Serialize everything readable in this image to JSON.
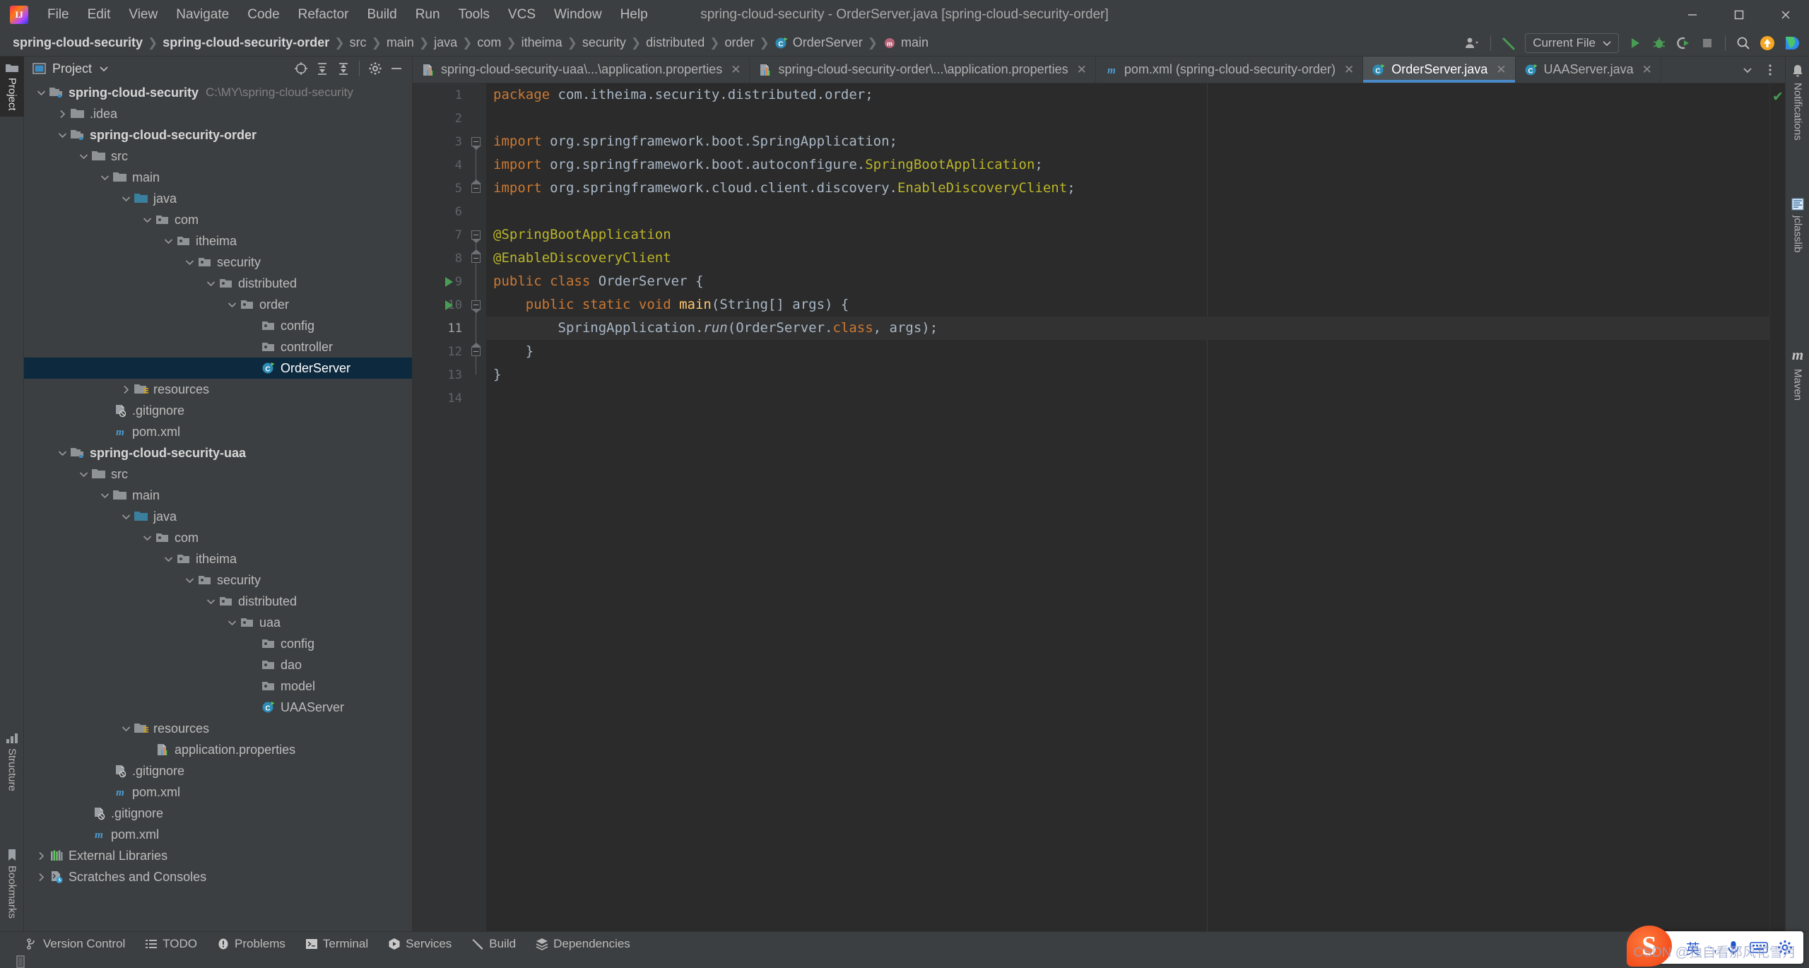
{
  "window": {
    "title": "spring-cloud-security - OrderServer.java [spring-cloud-security-order]",
    "logo_text": "IJ",
    "minimize": "—",
    "maximize": "▢",
    "close": "✕"
  },
  "menu": {
    "items": [
      "File",
      "Edit",
      "View",
      "Navigate",
      "Code",
      "Refactor",
      "Build",
      "Run",
      "Tools",
      "VCS",
      "Window",
      "Help"
    ]
  },
  "breadcrumb": {
    "items": [
      {
        "label": "spring-cloud-security",
        "bold": true,
        "icon": ""
      },
      {
        "label": "spring-cloud-security-order",
        "bold": true,
        "icon": ""
      },
      {
        "label": "src",
        "bold": false,
        "icon": ""
      },
      {
        "label": "main",
        "bold": false,
        "icon": ""
      },
      {
        "label": "java",
        "bold": false,
        "icon": ""
      },
      {
        "label": "com",
        "bold": false,
        "icon": ""
      },
      {
        "label": "itheima",
        "bold": false,
        "icon": ""
      },
      {
        "label": "security",
        "bold": false,
        "icon": ""
      },
      {
        "label": "distributed",
        "bold": false,
        "icon": ""
      },
      {
        "label": "order",
        "bold": false,
        "icon": ""
      },
      {
        "label": "OrderServer",
        "bold": false,
        "icon": "java-class-icon"
      },
      {
        "label": "main",
        "bold": false,
        "icon": "java-method-icon"
      }
    ],
    "separator": "❯"
  },
  "toolbar": {
    "account_icon": "user-icon",
    "build_icon": "hammer-icon",
    "run_config": "Current File",
    "run_icon": "run-icon",
    "debug_icon": "debug-icon",
    "run_coverage_icon": "run-with-coverage-icon",
    "stop_icon": "stop-icon",
    "search_icon": "search-everywhere-icon",
    "update_icon": "update-icon",
    "ide_icon": "ide-feature-icon"
  },
  "left_strip": {
    "tabs": [
      {
        "label": "Project",
        "active": true,
        "icon": "project-icon"
      },
      {
        "label": "Structure",
        "active": false,
        "icon": "structure-icon"
      },
      {
        "label": "Bookmarks",
        "active": false,
        "icon": "bookmark-icon"
      }
    ]
  },
  "right_strip": {
    "tabs": [
      {
        "label": "Notifications",
        "icon": "bell-icon"
      },
      {
        "label": "jclasslib",
        "icon": "jclasslib-icon"
      },
      {
        "label": "Maven",
        "icon": "maven-icon"
      }
    ]
  },
  "project_panel": {
    "title": "Project",
    "dropdown_icon": "chevron-down-icon",
    "header_buttons": [
      "select-opened-file-icon",
      "expand-all-icon",
      "collapse-all-icon",
      "settings-gear-icon",
      "hide-icon"
    ],
    "tree": [
      {
        "indent": 0,
        "arrow": "down",
        "icon": "module-folder",
        "label": "spring-cloud-security",
        "bold": true,
        "path": "C:\\MY\\spring-cloud-security",
        "selected": false
      },
      {
        "indent": 1,
        "arrow": "right",
        "icon": "folder",
        "label": ".idea",
        "bold": false,
        "path": "",
        "selected": false
      },
      {
        "indent": 1,
        "arrow": "down",
        "icon": "module-folder",
        "label": "spring-cloud-security-order",
        "bold": true,
        "path": "",
        "selected": false
      },
      {
        "indent": 2,
        "arrow": "down",
        "icon": "folder",
        "label": "src",
        "bold": false,
        "path": "",
        "selected": false
      },
      {
        "indent": 3,
        "arrow": "down",
        "icon": "folder",
        "label": "main",
        "bold": false,
        "path": "",
        "selected": false
      },
      {
        "indent": 4,
        "arrow": "down",
        "icon": "source-folder",
        "label": "java",
        "bold": false,
        "path": "",
        "selected": false
      },
      {
        "indent": 5,
        "arrow": "down",
        "icon": "package",
        "label": "com",
        "bold": false,
        "path": "",
        "selected": false
      },
      {
        "indent": 6,
        "arrow": "down",
        "icon": "package",
        "label": "itheima",
        "bold": false,
        "path": "",
        "selected": false
      },
      {
        "indent": 7,
        "arrow": "down",
        "icon": "package",
        "label": "security",
        "bold": false,
        "path": "",
        "selected": false
      },
      {
        "indent": 8,
        "arrow": "down",
        "icon": "package",
        "label": "distributed",
        "bold": false,
        "path": "",
        "selected": false
      },
      {
        "indent": 9,
        "arrow": "down",
        "icon": "package",
        "label": "order",
        "bold": false,
        "path": "",
        "selected": false
      },
      {
        "indent": 10,
        "arrow": "none",
        "icon": "package",
        "label": "config",
        "bold": false,
        "path": "",
        "selected": false
      },
      {
        "indent": 10,
        "arrow": "none",
        "icon": "package",
        "label": "controller",
        "bold": false,
        "path": "",
        "selected": false
      },
      {
        "indent": 10,
        "arrow": "none",
        "icon": "java-class",
        "label": "OrderServer",
        "bold": false,
        "path": "",
        "selected": true
      },
      {
        "indent": 4,
        "arrow": "right",
        "icon": "resource-folder",
        "label": "resources",
        "bold": false,
        "path": "",
        "selected": false
      },
      {
        "indent": 3,
        "arrow": "none",
        "icon": "gitignore",
        "label": ".gitignore",
        "bold": false,
        "path": "",
        "selected": false
      },
      {
        "indent": 3,
        "arrow": "none",
        "icon": "maven-file",
        "label": "pom.xml",
        "bold": false,
        "path": "",
        "selected": false
      },
      {
        "indent": 1,
        "arrow": "down",
        "icon": "module-folder",
        "label": "spring-cloud-security-uaa",
        "bold": true,
        "path": "",
        "selected": false
      },
      {
        "indent": 2,
        "arrow": "down",
        "icon": "folder",
        "label": "src",
        "bold": false,
        "path": "",
        "selected": false
      },
      {
        "indent": 3,
        "arrow": "down",
        "icon": "folder",
        "label": "main",
        "bold": false,
        "path": "",
        "selected": false
      },
      {
        "indent": 4,
        "arrow": "down",
        "icon": "source-folder",
        "label": "java",
        "bold": false,
        "path": "",
        "selected": false
      },
      {
        "indent": 5,
        "arrow": "down",
        "icon": "package",
        "label": "com",
        "bold": false,
        "path": "",
        "selected": false
      },
      {
        "indent": 6,
        "arrow": "down",
        "icon": "package",
        "label": "itheima",
        "bold": false,
        "path": "",
        "selected": false
      },
      {
        "indent": 7,
        "arrow": "down",
        "icon": "package",
        "label": "security",
        "bold": false,
        "path": "",
        "selected": false
      },
      {
        "indent": 8,
        "arrow": "down",
        "icon": "package",
        "label": "distributed",
        "bold": false,
        "path": "",
        "selected": false
      },
      {
        "indent": 9,
        "arrow": "down",
        "icon": "package",
        "label": "uaa",
        "bold": false,
        "path": "",
        "selected": false
      },
      {
        "indent": 10,
        "arrow": "none",
        "icon": "package",
        "label": "config",
        "bold": false,
        "path": "",
        "selected": false
      },
      {
        "indent": 10,
        "arrow": "none",
        "icon": "package",
        "label": "dao",
        "bold": false,
        "path": "",
        "selected": false
      },
      {
        "indent": 10,
        "arrow": "none",
        "icon": "package",
        "label": "model",
        "bold": false,
        "path": "",
        "selected": false
      },
      {
        "indent": 10,
        "arrow": "none",
        "icon": "java-class",
        "label": "UAAServer",
        "bold": false,
        "path": "",
        "selected": false
      },
      {
        "indent": 4,
        "arrow": "down",
        "icon": "resource-folder",
        "label": "resources",
        "bold": false,
        "path": "",
        "selected": false
      },
      {
        "indent": 5,
        "arrow": "none",
        "icon": "properties",
        "label": "application.properties",
        "bold": false,
        "path": "",
        "selected": false
      },
      {
        "indent": 3,
        "arrow": "none",
        "icon": "gitignore",
        "label": ".gitignore",
        "bold": false,
        "path": "",
        "selected": false
      },
      {
        "indent": 3,
        "arrow": "none",
        "icon": "maven-file",
        "label": "pom.xml",
        "bold": false,
        "path": "",
        "selected": false
      },
      {
        "indent": 2,
        "arrow": "none",
        "icon": "gitignore",
        "label": ".gitignore",
        "bold": false,
        "path": "",
        "selected": false
      },
      {
        "indent": 2,
        "arrow": "none",
        "icon": "maven-file",
        "label": "pom.xml",
        "bold": false,
        "path": "",
        "selected": false
      },
      {
        "indent": 0,
        "arrow": "right",
        "icon": "external-libraries",
        "label": "External Libraries",
        "bold": false,
        "path": "",
        "selected": false
      },
      {
        "indent": 0,
        "arrow": "right",
        "icon": "scratches",
        "label": "Scratches and Consoles",
        "bold": false,
        "path": "",
        "selected": false
      }
    ]
  },
  "editor_tabs": {
    "accent_color": "#4a88c7",
    "tabs": [
      {
        "label": "spring-cloud-security-uaa\\...\\application.properties",
        "icon": "properties-icon",
        "active": false,
        "close": "✕"
      },
      {
        "label": "spring-cloud-security-order\\...\\application.properties",
        "icon": "properties-icon",
        "active": false,
        "close": "✕"
      },
      {
        "label": "pom.xml (spring-cloud-security-order)",
        "icon": "maven-icon",
        "active": false,
        "close": "✕"
      },
      {
        "label": "OrderServer.java",
        "icon": "java-class-icon",
        "active": true,
        "close": "✕"
      },
      {
        "label": "UAAServer.java",
        "icon": "java-class-icon",
        "active": false,
        "close": "✕"
      }
    ],
    "overflow_icon": "chevron-down-icon",
    "options_icon": "more-vertical-icon"
  },
  "editor": {
    "current_line": 11,
    "inspection_status": "✔",
    "lines": [
      {
        "n": 1,
        "tokens": [
          {
            "t": "package ",
            "c": "kw"
          },
          {
            "t": "com.itheima.security.distributed.order;",
            "c": "pln"
          }
        ]
      },
      {
        "n": 2,
        "tokens": []
      },
      {
        "n": 3,
        "tokens": [
          {
            "t": "import ",
            "c": "kw"
          },
          {
            "t": "org.springframework.boot.SpringApplication;",
            "c": "pln"
          }
        ]
      },
      {
        "n": 4,
        "tokens": [
          {
            "t": "import ",
            "c": "kw"
          },
          {
            "t": "org.springframework.boot.autoconfigure.",
            "c": "pln"
          },
          {
            "t": "SpringBootApplication",
            "c": "typ"
          },
          {
            "t": ";",
            "c": "pln"
          }
        ]
      },
      {
        "n": 5,
        "tokens": [
          {
            "t": "import ",
            "c": "kw"
          },
          {
            "t": "org.springframework.cloud.client.discovery.",
            "c": "pln"
          },
          {
            "t": "EnableDiscoveryClient",
            "c": "typ"
          },
          {
            "t": ";",
            "c": "pln"
          }
        ]
      },
      {
        "n": 6,
        "tokens": []
      },
      {
        "n": 7,
        "tokens": [
          {
            "t": "@SpringBootApplication",
            "c": "ann"
          }
        ]
      },
      {
        "n": 8,
        "tokens": [
          {
            "t": "@EnableDiscoveryClient",
            "c": "ann"
          }
        ]
      },
      {
        "n": 9,
        "tokens": [
          {
            "t": "public class ",
            "c": "kw"
          },
          {
            "t": "OrderServer {",
            "c": "pln"
          }
        ]
      },
      {
        "n": 10,
        "tokens": [
          {
            "t": "    ",
            "c": "pln"
          },
          {
            "t": "public static void ",
            "c": "kw"
          },
          {
            "t": "main",
            "c": "mth"
          },
          {
            "t": "(String[] args) {",
            "c": "pln"
          }
        ]
      },
      {
        "n": 11,
        "tokens": [
          {
            "t": "        SpringApplication.",
            "c": "pln"
          },
          {
            "t": "run",
            "c": "itl"
          },
          {
            "t": "(OrderServer.",
            "c": "pln"
          },
          {
            "t": "class",
            "c": "kw"
          },
          {
            "t": ", args);",
            "c": "pln"
          }
        ]
      },
      {
        "n": 12,
        "tokens": [
          {
            "t": "    }",
            "c": "pln"
          }
        ]
      },
      {
        "n": 13,
        "tokens": [
          {
            "t": "}",
            "c": "pln"
          }
        ]
      },
      {
        "n": 14,
        "tokens": []
      }
    ],
    "run_markers": [
      9,
      10
    ]
  },
  "statusbar": {
    "tools": [
      {
        "label": "Version Control",
        "icon": "vcs-branch-icon"
      },
      {
        "label": "TODO",
        "icon": "todo-list-icon"
      },
      {
        "label": "Problems",
        "icon": "problems-icon"
      },
      {
        "label": "Terminal",
        "icon": "terminal-icon"
      },
      {
        "label": "Services",
        "icon": "services-icon"
      },
      {
        "label": "Build",
        "icon": "build-hammer-icon"
      },
      {
        "label": "Dependencies",
        "icon": "dependencies-icon"
      }
    ],
    "memory_icon": "memory-indicator-icon"
  },
  "ime": {
    "logo": "S",
    "mode": "英",
    "punctuation": "·,",
    "voice_icon": "microphone-icon",
    "keyboard_icon": "keyboard-icon",
    "settings_icon": "ime-settings-icon",
    "watermark": "CSDN @独自看那风花雪月"
  }
}
